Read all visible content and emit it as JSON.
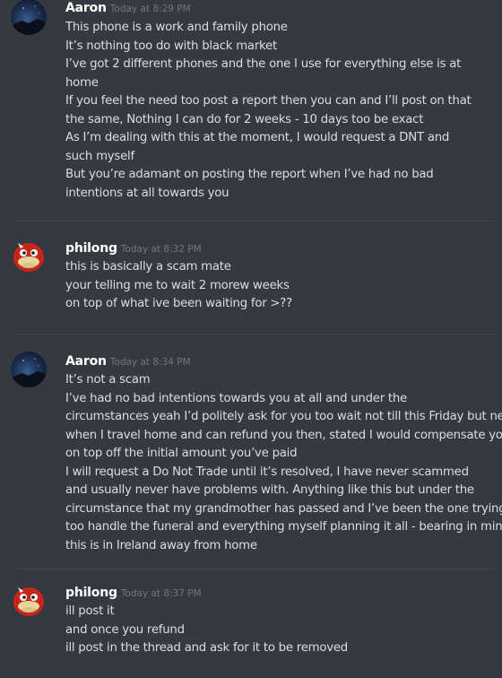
{
  "groups": [
    {
      "author": "Aaron",
      "timestamp": "Today at 8:29 PM",
      "avatar": "aaron-avatar",
      "lines": [
        "This phone is a work and family phone",
        "It’s nothing too do with black market",
        "I’ve got 2 different phones and the one I use for everything else is at",
        "home",
        "If you feel the need too post a report then you can and I’ll post on that",
        "the same, Nothing I can do for 2 weeks - 10 days too be exact",
        "As I’m dealing with this at the moment, I would request a DNT and",
        "such myself",
        "But you’re adamant on posting the report when I’ve had no bad",
        "intentions at all towards you"
      ]
    },
    {
      "author": "philong",
      "timestamp": "Today at 8:32 PM",
      "avatar": "philong-avatar",
      "lines": [
        "this is basically a scam mate",
        "your telling me to wait 2 morew weeks",
        "on top of what ive been waiting for >??"
      ]
    },
    {
      "author": "Aaron",
      "timestamp": "Today at 8:34 PM",
      "avatar": "aaron-avatar",
      "lines": [
        "It’s not a scam",
        "I’ve had no bad intentions towards you at all and under the",
        "circumstances yeah I’d politely ask for you too wait not till this Friday but next",
        "when I travel home and can refund you then, stated I would compensate you",
        "on top off the initial amount you’ve paid",
        "I will request a Do Not Trade until it’s resolved, I have never scammed",
        "and usually never have problems with. Anything like this but under the",
        "circumstance that my grandmother has passed and I’ve been the one trying",
        "too handle the funeral and everything myself planning it all - bearing in mind",
        "this is in Ireland away from home"
      ]
    },
    {
      "author": "philong",
      "timestamp": "Today at 8:37 PM",
      "avatar": "philong-avatar",
      "lines": [
        "ill post it",
        "and once you refund",
        "ill post in the thread and ask for it to be removed"
      ]
    }
  ],
  "colors": {
    "background": "#36393f",
    "username": "#ffffff",
    "timestamp": "#72767d",
    "message_text": "#dcddde",
    "divider": "#42454a"
  }
}
